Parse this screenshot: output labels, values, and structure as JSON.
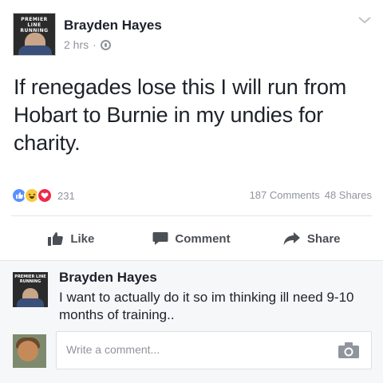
{
  "post": {
    "author": "Brayden Hayes",
    "time": "2 hrs",
    "separator": "·",
    "avatar_band_text": "PREMIER LINE RUNNING",
    "text": "If renegades lose this I will run from Hobart to Burnie in my undies for charity."
  },
  "counts": {
    "reactions": "231",
    "comments": "187 Comments",
    "shares": "48 Shares"
  },
  "actions": {
    "like": "Like",
    "comment": "Comment",
    "share": "Share"
  },
  "comment": {
    "author": "Brayden Hayes",
    "text": "I want to actually do it so im thinking ill need 9-10 months of training..",
    "avatar_band_text": "PREMIER LINE RUNNING"
  },
  "composer": {
    "placeholder": "Write a comment..."
  },
  "colors": {
    "like_blue": "#5890ff",
    "haha_yellow": "#f7c843",
    "love_red": "#f0284a",
    "muted_text": "#90949c",
    "action_text": "#4b4f56"
  },
  "icons": {
    "menu": "chevron-down-icon",
    "privacy": "globe-icon",
    "like_action": "thumbs-up-icon",
    "comment_action": "speech-bubble-icon",
    "share_action": "share-arrow-icon",
    "camera": "camera-icon"
  }
}
